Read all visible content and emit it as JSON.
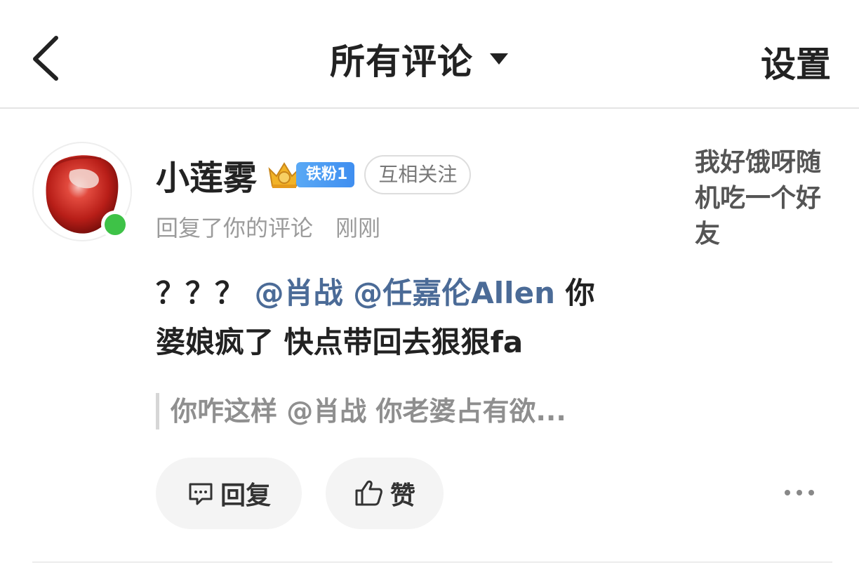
{
  "header": {
    "title": "所有评论",
    "settings_label": "设置"
  },
  "comment": {
    "username": "小莲雾",
    "badge": "铁粉1",
    "follow_status": "互相关注",
    "action": "回复了你的评论",
    "time": "刚刚",
    "text_prefix": "？？？",
    "mention_1": "@肖战",
    "mention_2": "@任嘉伦Allen",
    "text_line1_suffix": "你",
    "text_line2": "婆娘疯了  快点带回去狠狠fa",
    "quoted": "你咋这样 @肖战 你老婆占有欲...",
    "post_excerpt": "我好饿呀随机吃一个好友"
  },
  "actions": {
    "reply_label": "回复",
    "like_label": "赞"
  },
  "colors": {
    "online": "#3ec247",
    "mention": "#4b6b97",
    "badge_blue": "#3f8ef0"
  },
  "icons": [
    "back-arrow-icon",
    "caret-down-icon",
    "crown-icon",
    "comment-icon",
    "thumbs-up-icon",
    "more-icon"
  ]
}
